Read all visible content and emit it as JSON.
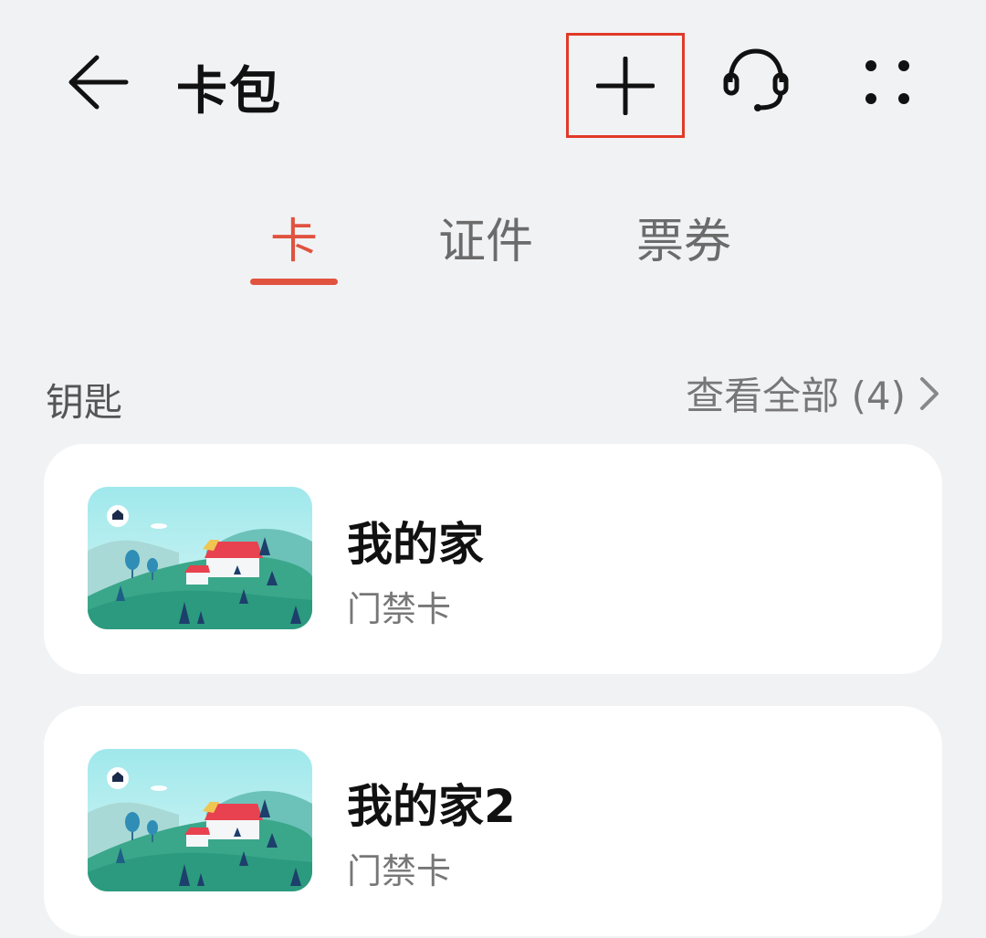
{
  "header": {
    "title": "卡包",
    "icons": [
      "back-arrow-icon",
      "plus-icon",
      "headset-icon",
      "more-grid-icon"
    ]
  },
  "tabs": [
    {
      "label": "卡",
      "active": true
    },
    {
      "label": "证件",
      "active": false
    },
    {
      "label": "票券",
      "active": false
    }
  ],
  "section": {
    "title": "钥匙",
    "view_all": "查看全部 (4)"
  },
  "cards": [
    {
      "name": "我的家",
      "type": "门禁卡"
    },
    {
      "name": "我的家2",
      "type": "门禁卡"
    }
  ],
  "colors": {
    "accent": "#e0533f",
    "highlight_box": "#e03a28",
    "background": "#f1f2f4"
  }
}
